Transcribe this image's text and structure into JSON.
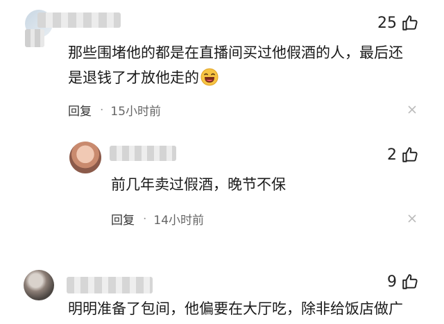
{
  "comments": [
    {
      "likes": "25",
      "text_lines": [
        "那些围堵他的都是在直播间买过他假酒的人，最后还",
        "是退钱了才放他走的"
      ],
      "reply_label": "回复",
      "time": "15小时前"
    },
    {
      "likes": "2",
      "text_lines": [
        "前几年卖过假酒，晚节不保"
      ],
      "reply_label": "回复",
      "time": "14小时前"
    },
    {
      "likes": "9",
      "text_lines": [
        "明明准备了包间，他偏要在大厅吃，除非给饭店做广"
      ]
    }
  ],
  "colors": {
    "text": "#1a1a1a",
    "muted": "#666666",
    "icon": "#222222"
  }
}
